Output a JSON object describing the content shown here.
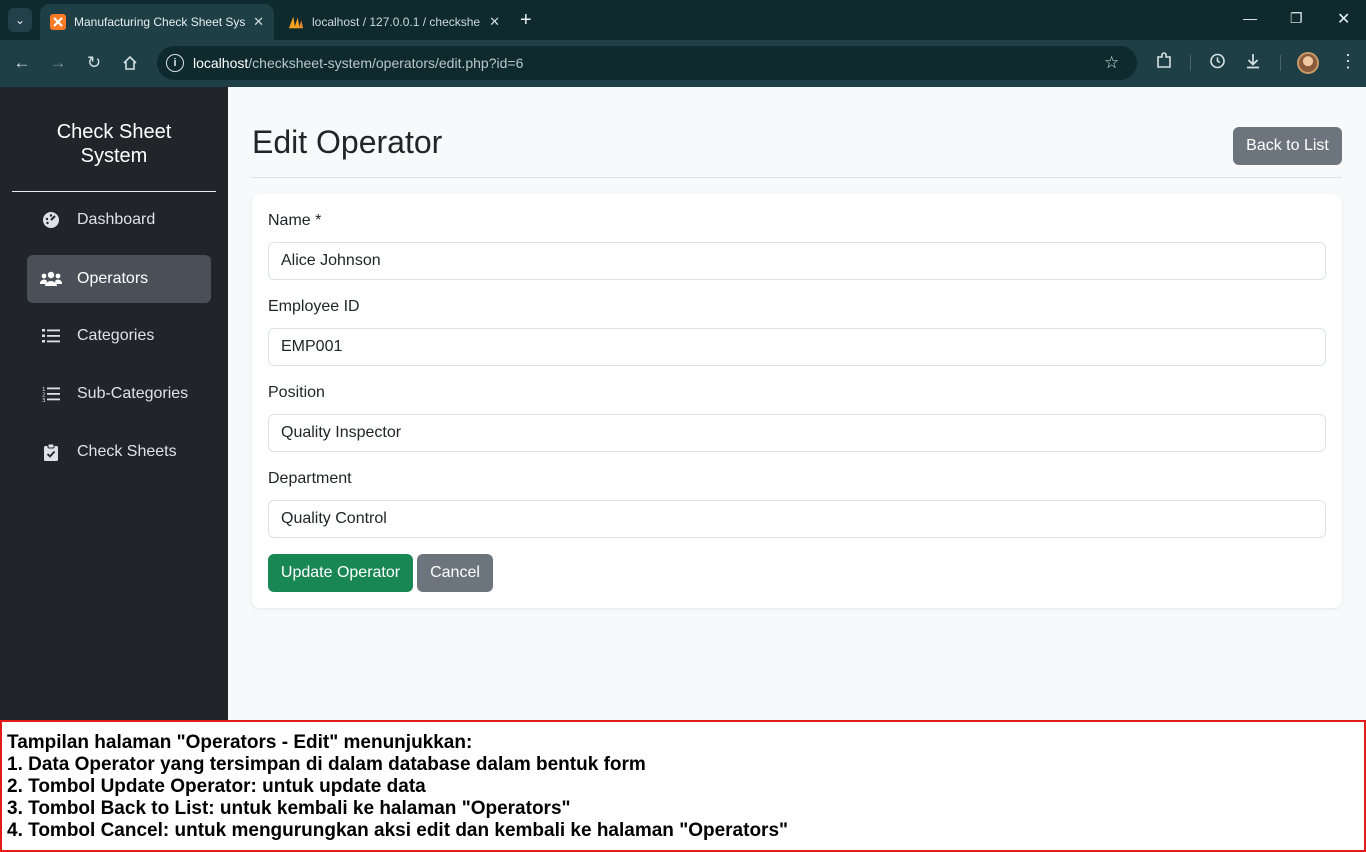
{
  "browser": {
    "tabs": [
      {
        "title": "Manufacturing Check Sheet Sys",
        "active": true
      },
      {
        "title": "localhost / 127.0.0.1 / checkshe",
        "active": false
      }
    ],
    "url_host": "localhost",
    "url_path": "/checksheet-system/operators/edit.php?id=6"
  },
  "sidebar": {
    "brand": "Check Sheet System",
    "items": [
      {
        "label": "Dashboard",
        "icon": "gauge-icon",
        "active": false
      },
      {
        "label": "Operators",
        "icon": "users-icon",
        "active": true
      },
      {
        "label": "Categories",
        "icon": "list-icon",
        "active": false
      },
      {
        "label": "Sub-Categories",
        "icon": "list-ol-icon",
        "active": false
      },
      {
        "label": "Check Sheets",
        "icon": "clipboard-check-icon",
        "active": false
      }
    ]
  },
  "main": {
    "title": "Edit Operator",
    "back_button": "Back to List",
    "form": {
      "name_label": "Name *",
      "name_value": "Alice Johnson",
      "employee_id_label": "Employee ID",
      "employee_id_value": "EMP001",
      "position_label": "Position",
      "position_value": "Quality Inspector",
      "department_label": "Department",
      "department_value": "Quality Control"
    },
    "update_button": "Update Operator",
    "cancel_button": "Cancel"
  },
  "annotation": {
    "lines": [
      "Tampilan halaman \"Operators - Edit\" menunjukkan:",
      "1. Data Operator yang tersimpan di dalam database dalam bentuk form",
      "2. Tombol Update Operator: untuk update data",
      "3. Tombol Back to List: untuk kembali ke halaman \"Operators\"",
      "4. Tombol Cancel: untuk mengurungkan aksi edit dan kembali ke halaman \"Operators\""
    ],
    "border_color": "#e31b1b"
  },
  "colors": {
    "sidebar_bg": "#212529",
    "active_nav_bg": "#495057",
    "update_green": "#198754",
    "secondary_gray": "#6c757d",
    "browser_frame": "#1e3f45"
  }
}
